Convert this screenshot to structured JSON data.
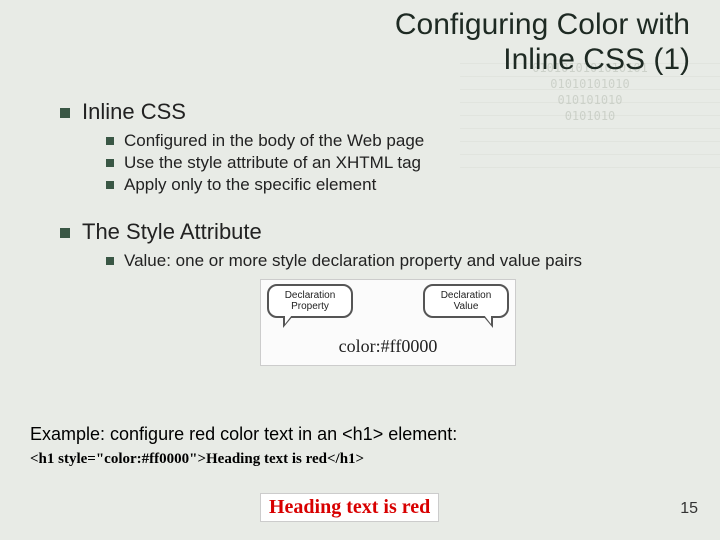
{
  "title": {
    "line1": "Configuring Color with",
    "line2": "Inline CSS (1)"
  },
  "sections": [
    {
      "heading": "Inline CSS",
      "items": [
        "Configured in the body of the Web page",
        "Use the style attribute of an XHTML tag",
        "Apply only to the specific element"
      ]
    },
    {
      "heading": "The Style Attribute",
      "items": [
        "Value: one or more style declaration property and value pairs"
      ]
    }
  ],
  "diagram": {
    "bubble_left": "Declaration\nProperty",
    "bubble_right": "Declaration\nValue",
    "code": "color:#ff0000"
  },
  "example": {
    "intro": "Example: configure red color text in an <h1> element:",
    "code": "<h1 style=\"color:#ff0000\">Heading text is red</h1>",
    "rendered": "Heading text is red"
  },
  "page_number": "15"
}
